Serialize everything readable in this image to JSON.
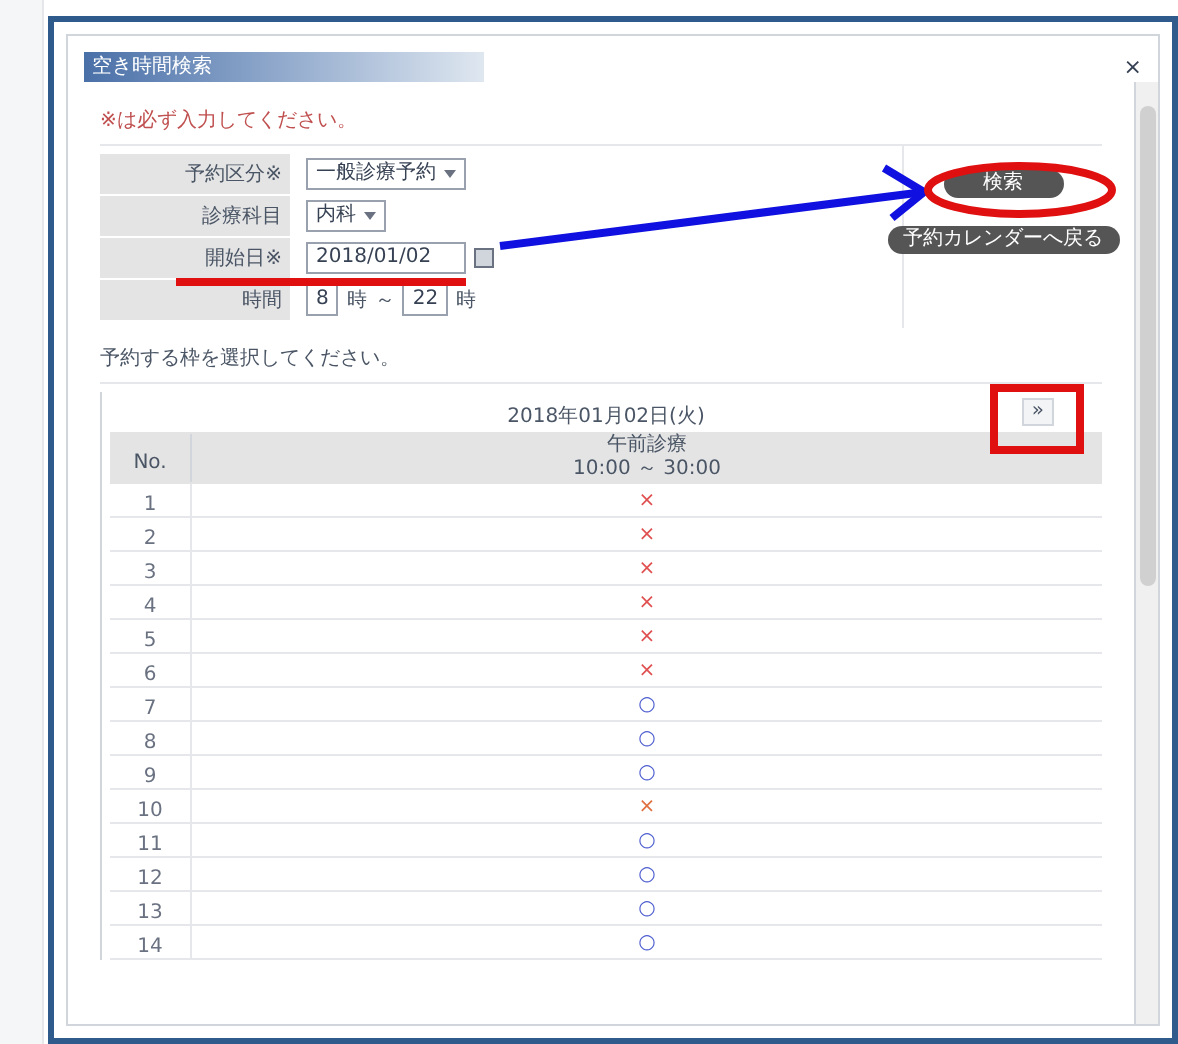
{
  "window": {
    "title": "空き時間検索",
    "close": "×"
  },
  "instruction": "※は必ず入力してください。",
  "fields": [
    {
      "kind": "select",
      "label": "予約区分※",
      "value": "一般診療予約"
    },
    {
      "kind": "select",
      "label": "診療科目",
      "value": "内科"
    },
    {
      "kind": "date",
      "label": "開始日※",
      "value": "2018/01/02"
    },
    {
      "kind": "range",
      "label": "時間",
      "from": "8",
      "from_unit": "時",
      "sep": "～",
      "to": "22",
      "to_unit": "時"
    }
  ],
  "buttons": [
    {
      "label": "検索"
    },
    {
      "label": "予約カレンダーへ戻る"
    }
  ],
  "select_prompt": "予約する枠を選択してください。",
  "table": {
    "date": "2018年01月02日(火)",
    "next": "»",
    "no_header": "No.",
    "slot_header": "午前診療",
    "slot_time": "10:00 ～ 30:00",
    "rows": [
      {
        "no": "1",
        "mark": "×",
        "color": "#e05050"
      },
      {
        "no": "2",
        "mark": "×",
        "color": "#e05050"
      },
      {
        "no": "3",
        "mark": "×",
        "color": "#e05050"
      },
      {
        "no": "4",
        "mark": "×",
        "color": "#e05050"
      },
      {
        "no": "5",
        "mark": "×",
        "color": "#e05050"
      },
      {
        "no": "6",
        "mark": "×",
        "color": "#e05050"
      },
      {
        "no": "7",
        "mark": "○",
        "color": "#5060d0"
      },
      {
        "no": "8",
        "mark": "○",
        "color": "#5060d0"
      },
      {
        "no": "9",
        "mark": "○",
        "color": "#5060d0"
      },
      {
        "no": "10",
        "mark": "×",
        "color": "#e07040"
      },
      {
        "no": "11",
        "mark": "○",
        "color": "#5060d0"
      },
      {
        "no": "12",
        "mark": "○",
        "color": "#5060d0"
      },
      {
        "no": "13",
        "mark": "○",
        "color": "#5060d0"
      },
      {
        "no": "14",
        "mark": "○",
        "color": "#5060d0"
      }
    ]
  }
}
